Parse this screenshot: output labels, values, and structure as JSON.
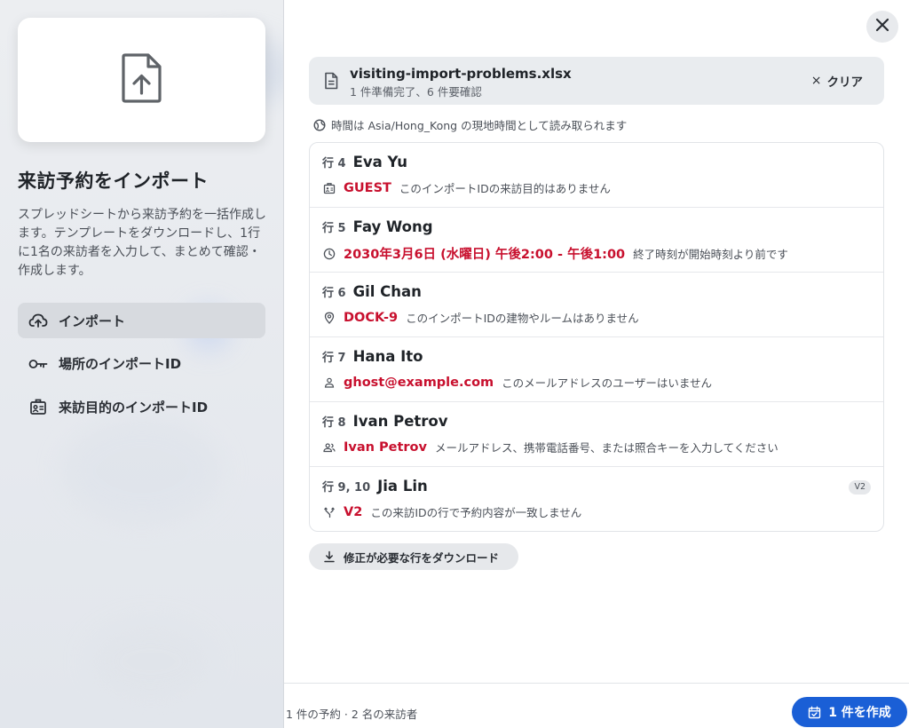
{
  "sidebar": {
    "title": "来訪予約をインポート",
    "description": "スプレッドシートから来訪予約を一括作成します。テンプレートをダウンロードし、1行に1名の来訪者を入力して、まとめて確認・作成します。",
    "hero_icon": "file-upload-icon",
    "nav": [
      {
        "label": "インポート",
        "icon": "cloud-upload-icon",
        "active": true
      },
      {
        "label": "場所のインポートID",
        "icon": "key-icon",
        "active": false
      },
      {
        "label": "来訪目的のインポートID",
        "icon": "badge-icon",
        "active": false
      }
    ]
  },
  "file": {
    "name": "visiting-import-problems.xlsx",
    "status": "1 件準備完了、6 件要確認",
    "clear_label": "クリア",
    "clear_icon": "×"
  },
  "timezone_note": "時間は Asia/Hong_Kong の現地時間として読み取られます",
  "rows": [
    {
      "row": "行 4",
      "name": "Eva Yu",
      "icon": "badge-icon",
      "value": "GUEST",
      "message": "このインポートIDの来訪目的はありません",
      "badge": ""
    },
    {
      "row": "行 5",
      "name": "Fay Wong",
      "icon": "clock-icon",
      "value": "2030年3月6日 (水曜日) 午後2:00 - 午後1:00",
      "message": "終了時刻が開始時刻より前です",
      "badge": ""
    },
    {
      "row": "行 6",
      "name": "Gil Chan",
      "icon": "location-pin-icon",
      "value": "DOCK-9",
      "message": "このインポートIDの建物やルームはありません",
      "badge": ""
    },
    {
      "row": "行 7",
      "name": "Hana Ito",
      "icon": "person-icon",
      "value": "ghost@example.com",
      "message": "このメールアドレスのユーザーはいません",
      "badge": ""
    },
    {
      "row": "行 8",
      "name": "Ivan Petrov",
      "icon": "people-icon",
      "value": "Ivan Petrov",
      "message": "メールアドレス、携帯電話番号、または照合キーを入力してください",
      "badge": ""
    },
    {
      "row": "行 9, 10",
      "name": "Jia Lin",
      "icon": "merge-icon",
      "value": "V2",
      "message": "この来訪IDの行で予約内容が一致しません",
      "badge": "V2"
    }
  ],
  "download_label": "修正が必要な行をダウンロード",
  "footer": {
    "summary": "1 件の予約 · 2 名の来訪者",
    "create_label": "1 件を作成"
  },
  "colors": {
    "error": "#c8102e",
    "primary": "#1a5fd6"
  }
}
